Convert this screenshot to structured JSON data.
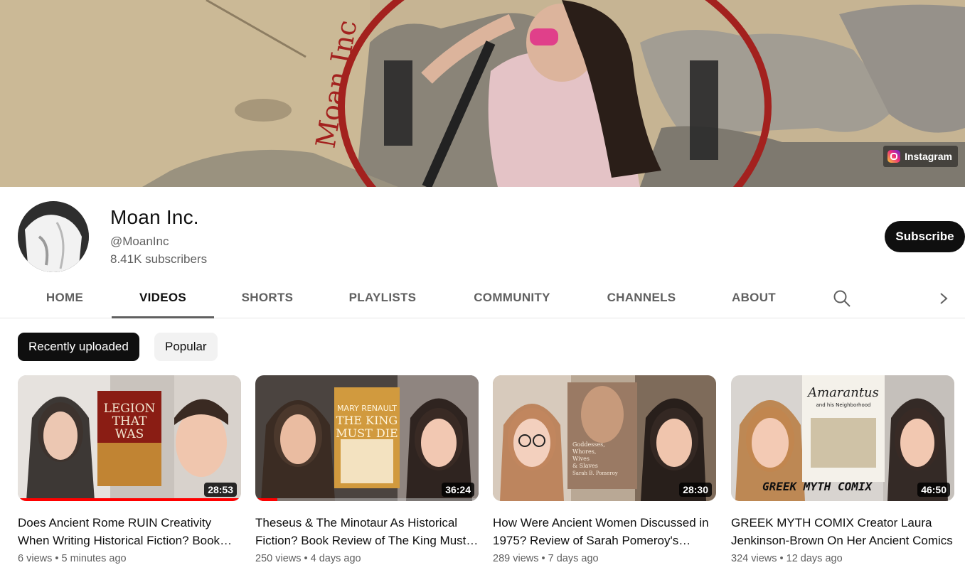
{
  "banner": {
    "watermark_text": "Moan Inc",
    "link_label": "Instagram",
    "link_icon": "instagram-icon"
  },
  "channel": {
    "name": "Moan Inc.",
    "handle": "@MoanInc",
    "subscribers": "8.41K subscribers",
    "subscribe_label": "Subscribe"
  },
  "tabs": [
    {
      "label": "HOME"
    },
    {
      "label": "VIDEOS",
      "active": true
    },
    {
      "label": "SHORTS"
    },
    {
      "label": "PLAYLISTS"
    },
    {
      "label": "COMMUNITY"
    },
    {
      "label": "CHANNELS"
    },
    {
      "label": "ABOUT"
    }
  ],
  "tab_icons": [
    "search-icon",
    "chevron-right-icon"
  ],
  "chips": [
    {
      "label": "Recently uploaded",
      "selected": true
    },
    {
      "label": "Popular",
      "selected": false
    }
  ],
  "videos": [
    {
      "title": "Does Ancient Rome RUIN Creativity When Writing Historical Fiction? Book Review of Legion That Was",
      "duration": "28:53",
      "views": "6 views",
      "age": "5 minutes ago",
      "watched_fraction": 1.0,
      "book_cover_lines": [
        "LEGION",
        "THAT",
        "WAS"
      ]
    },
    {
      "title": "Theseus & The Minotaur As Historical Fiction? Book Review of The King Must Die",
      "duration": "36:24",
      "views": "250 views",
      "age": "4 days ago",
      "watched_fraction": 0.1,
      "book_cover_lines": [
        "MARY RENAULT",
        "THE KING",
        "MUST DIE"
      ]
    },
    {
      "title": "How Were Ancient Women Discussed in 1975? Review of Sarah Pomeroy's Goddesses, Whores, Wives & Slaves",
      "duration": "28:30",
      "views": "289 views",
      "age": "7 days ago",
      "watched_fraction": 0,
      "book_cover_lines": [
        "Goddesses,",
        "Whores,",
        "Wives",
        "& Slaves",
        "Sarah B. Pomeroy"
      ]
    },
    {
      "title": "GREEK MYTH COMIX Creator Laura Jenkinson-Brown On Her Ancient Comics",
      "duration": "46:50",
      "views": "324 views",
      "age": "12 days ago",
      "watched_fraction": 0,
      "book_cover_lines": [
        "Amarantus",
        "and his Neighborhood",
        "GREEK MYTH COMIX"
      ]
    }
  ],
  "colors": {
    "accent_red": "#ff0000",
    "text_primary": "#0f0f0f",
    "text_secondary": "#606060",
    "chip_selected_bg": "#0f0f0f",
    "chip_bg": "#f2f2f2"
  }
}
